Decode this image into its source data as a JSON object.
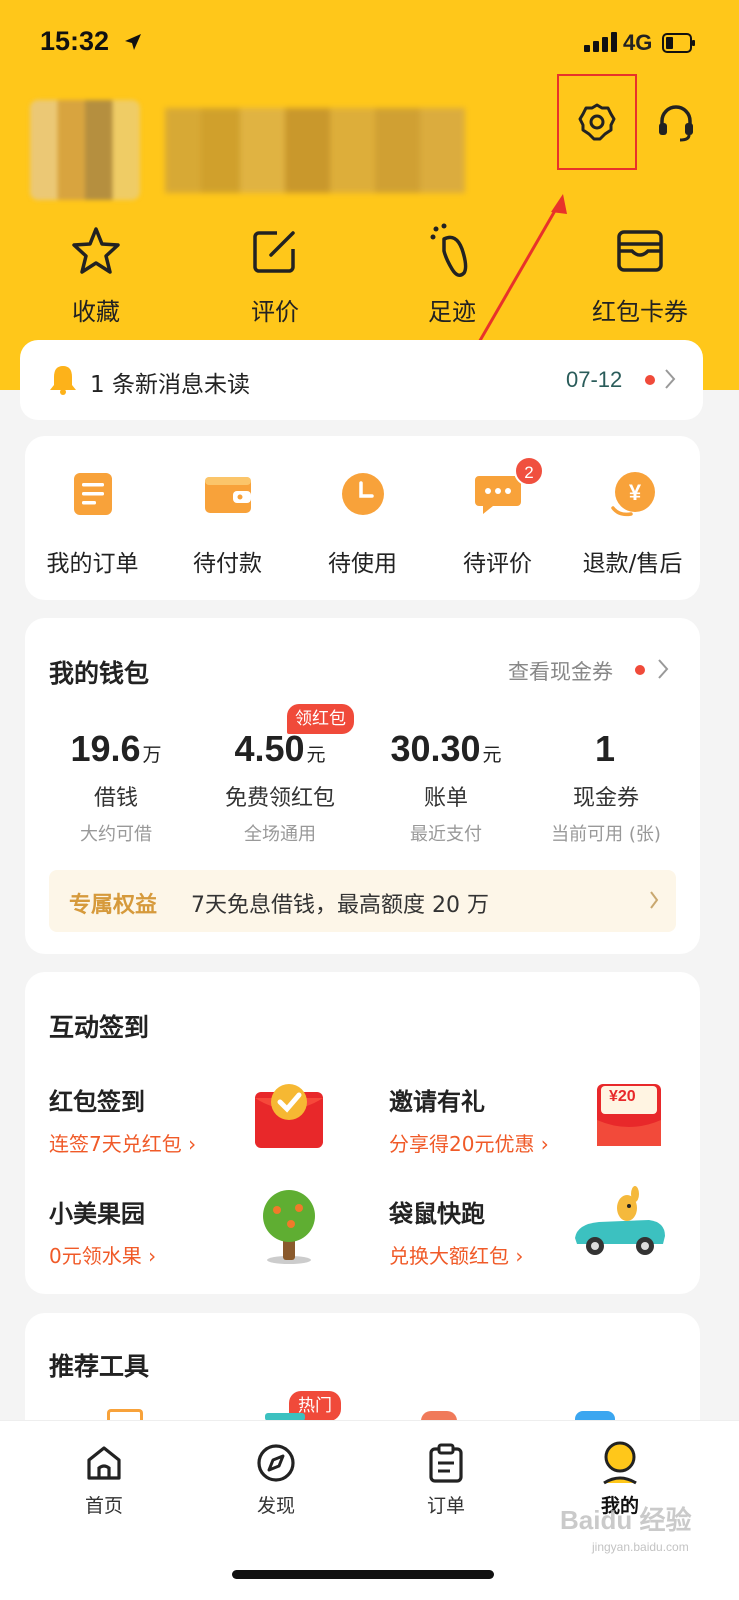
{
  "status_bar": {
    "time": "15:32",
    "network": "4G"
  },
  "quick_links": [
    {
      "label": "收藏",
      "icon": "star-icon"
    },
    {
      "label": "评价",
      "icon": "edit-icon"
    },
    {
      "label": "足迹",
      "icon": "footprint-icon"
    },
    {
      "label": "红包卡券",
      "icon": "wallet-card-icon"
    }
  ],
  "message": {
    "text": "1 条新消息未读",
    "date": "07-12"
  },
  "orders": [
    {
      "label": "我的订单",
      "icon": "order-list-icon"
    },
    {
      "label": "待付款",
      "icon": "wallet-pay-icon"
    },
    {
      "label": "待使用",
      "icon": "clock-icon"
    },
    {
      "label": "待评价",
      "icon": "comment-icon",
      "badge": "2"
    },
    {
      "label": "退款/售后",
      "icon": "refund-icon"
    }
  ],
  "wallet": {
    "title": "我的钱包",
    "link": "查看现金券",
    "tag": "领红包",
    "items": [
      {
        "value": "19.6",
        "unit": "万",
        "label": "借钱",
        "sub": "大约可借"
      },
      {
        "value": "4.50",
        "unit": "元",
        "label": "免费领红包",
        "sub": "全场通用"
      },
      {
        "value": "30.30",
        "unit": "元",
        "label": "账单",
        "sub": "最近支付"
      },
      {
        "value": "1",
        "unit": "",
        "label": "现金券",
        "sub": "当前可用 (张)"
      }
    ],
    "perk_title": "专属权益",
    "perk_text": "7天免息借钱，最高额度 20 万"
  },
  "checkin": {
    "title": "互动签到",
    "items": [
      {
        "title": "红包签到",
        "sub": "连签7天兑红包 ›"
      },
      {
        "title": "邀请有礼",
        "sub": "分享得20元优惠 ›",
        "coupon": "¥20"
      },
      {
        "title": "小美果园",
        "sub": "0元领水果 ›"
      },
      {
        "title": "袋鼠快跑",
        "sub": "兑换大额红包 ›"
      }
    ]
  },
  "tools": {
    "title": "推荐工具",
    "hot_tag": "热门"
  },
  "tabs": [
    {
      "label": "首页",
      "icon": "home-icon"
    },
    {
      "label": "发现",
      "icon": "compass-icon"
    },
    {
      "label": "订单",
      "icon": "clipboard-icon"
    },
    {
      "label": "我的",
      "icon": "profile-icon"
    }
  ],
  "watermark": {
    "text": "Baidu 经验",
    "sub": "jingyan.baidu.com"
  },
  "colors": {
    "brand_yellow": "#ffc71a",
    "accent_orange": "#f05a28",
    "badge_red": "#f04a3a"
  }
}
